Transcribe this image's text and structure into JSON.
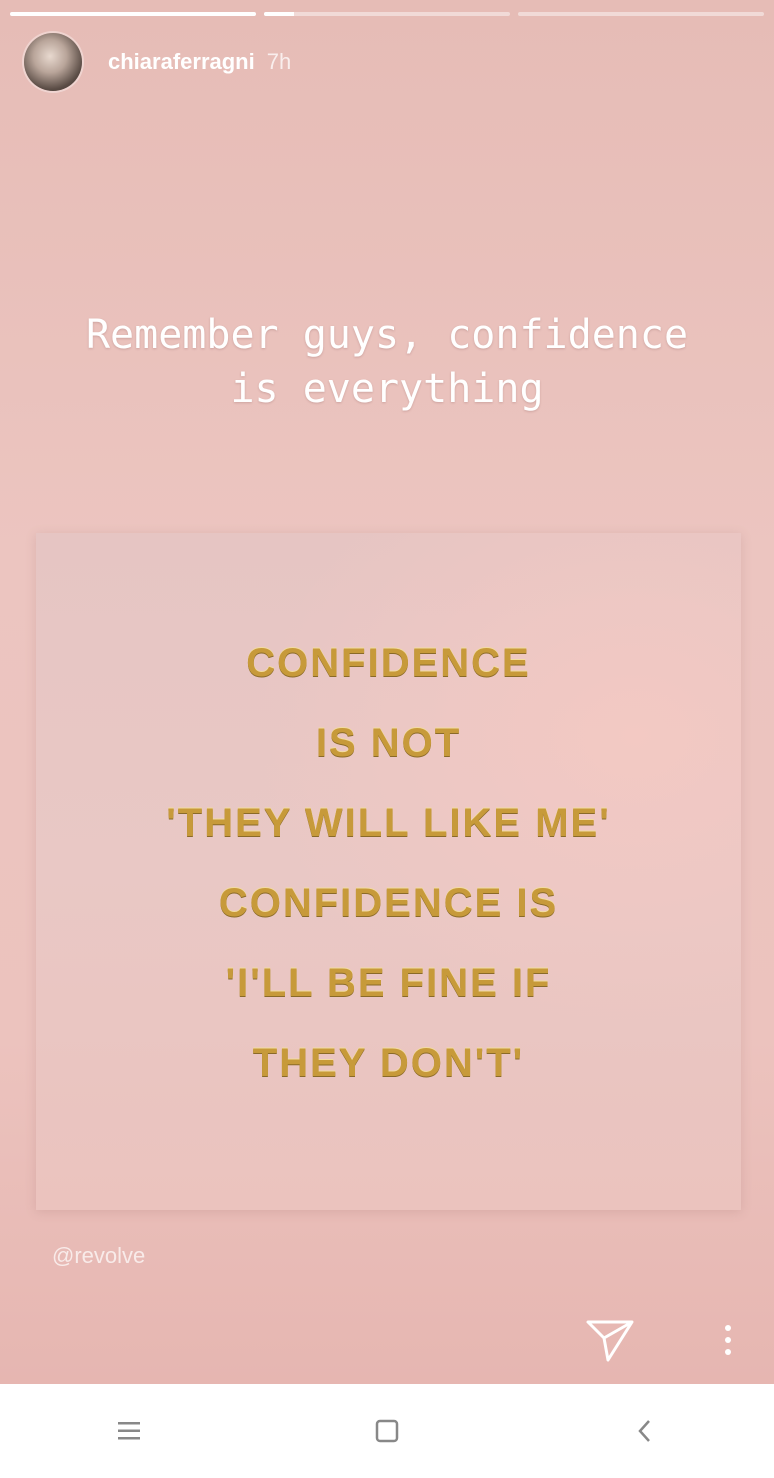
{
  "story": {
    "progress": [
      1.0,
      0.12,
      0.0
    ],
    "user": {
      "username": "chiaraferragni",
      "time": "7h",
      "avatar_icon": "profile-photo"
    },
    "caption": {
      "line1": "Remember guys, confidence",
      "line2": "is everything"
    },
    "quote_lines": [
      "CONFIDENCE",
      "IS NOT",
      "'THEY WILL LIKE ME'",
      "CONFIDENCE IS",
      "'I'LL BE FINE IF",
      "THEY DON'T'"
    ],
    "mention": "@revolve",
    "actions": {
      "send_icon": "paper-plane-icon",
      "more_icon": "more-vertical-icon"
    }
  },
  "navbar": {
    "icons": [
      "recent-apps-icon",
      "home-icon",
      "back-icon"
    ]
  },
  "colors": {
    "story_bg": "#ecc3be",
    "quote_gold": "#c79a3a",
    "text": "#ffffff"
  }
}
